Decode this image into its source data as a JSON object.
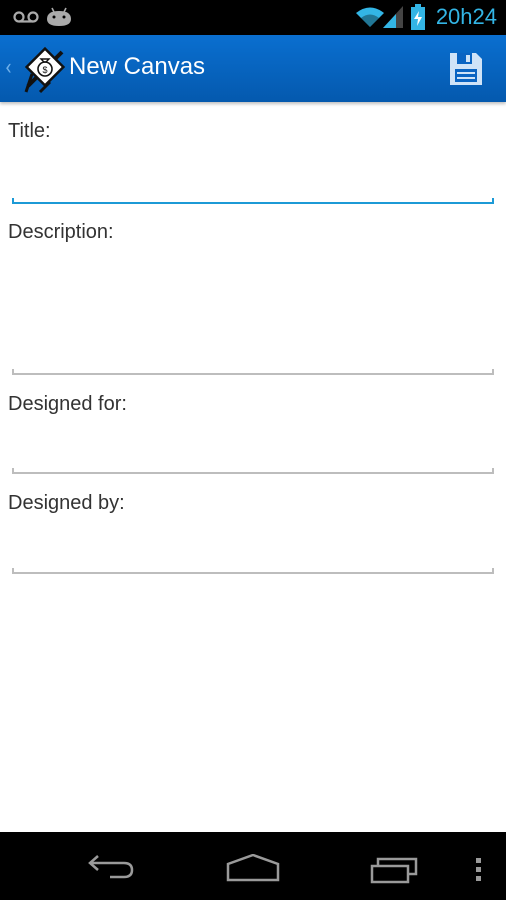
{
  "status_bar": {
    "time": "20h24",
    "left_icons": [
      "voicemail-icon",
      "android-debug-icon"
    ],
    "right_icons": [
      "wifi-icon",
      "signal-icon",
      "battery-charging-icon"
    ]
  },
  "action_bar": {
    "title": "New Canvas",
    "up_glyph": "‹",
    "app_icon": "money-bag-canvas-icon",
    "actions": [
      {
        "name": "save",
        "icon": "floppy-disk-icon"
      }
    ],
    "color": "#0a64c2"
  },
  "form": {
    "fields": [
      {
        "label": "Title:",
        "value": "",
        "placeholder": "",
        "focused": true
      },
      {
        "label": "Description:",
        "value": "",
        "placeholder": "",
        "focused": false
      },
      {
        "label": "Designed for:",
        "value": "",
        "placeholder": "",
        "focused": false
      },
      {
        "label": "Designed by:",
        "value": "",
        "placeholder": "",
        "focused": false
      }
    ],
    "focus_color": "#1c9ad6"
  },
  "nav_bar": {
    "buttons": [
      "back",
      "home",
      "recent-apps",
      "menu"
    ]
  }
}
